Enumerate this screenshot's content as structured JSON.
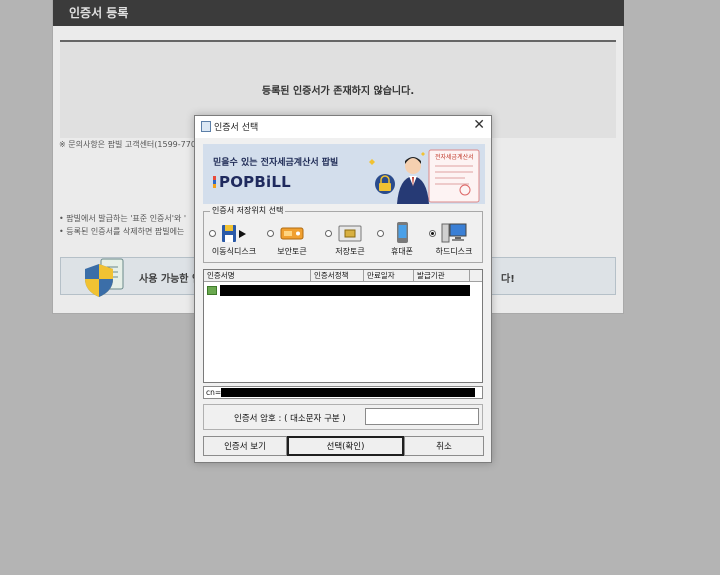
{
  "background": {
    "header_title": "인증서 등록",
    "empty_message": "등록된 인증서가 존재하지 않습니다.",
    "note": "※ 문의사항은 팝빌 고객센터(1599-7709",
    "bullets": [
      "• 팝빌에서 발급하는 '표준 인증서'와 '",
      "• 등록된 인증서를 삭제하면 팝빌에는"
    ],
    "banner_text": "사용 가능한 인",
    "banner_end": "다!"
  },
  "dialog": {
    "title": "인증서 선택",
    "close_label": "✕",
    "banner_tagline": "믿을수 있는 전자세금계산서 팝빌",
    "banner_logo": "POPBiLL",
    "banner_doc_title": "전자세금계산서",
    "storage_group_label": "인증서 저장위치 선택",
    "storage_options": [
      {
        "label": "이동식디스크",
        "selected": false
      },
      {
        "label": "보안토큰",
        "selected": false
      },
      {
        "label": "저장토큰",
        "selected": false
      },
      {
        "label": "휴대폰",
        "selected": false
      },
      {
        "label": "하드디스크",
        "selected": true
      }
    ],
    "list_columns": [
      "인증서명",
      "인증서정책",
      "만료일자",
      "발급기관"
    ],
    "cn_label": "cn=",
    "password_label": "인증서 암호 : ( 대소문자 구분 )",
    "password_value": "",
    "buttons": {
      "view": "인증서 보기",
      "ok": "선택(확인)",
      "cancel": "취소"
    }
  },
  "colors": {
    "overlay": "#b4b4b4",
    "header_dark": "#3b3b3b",
    "banner_bg": "#d3deec",
    "logo_navy": "#1f2a5e"
  }
}
